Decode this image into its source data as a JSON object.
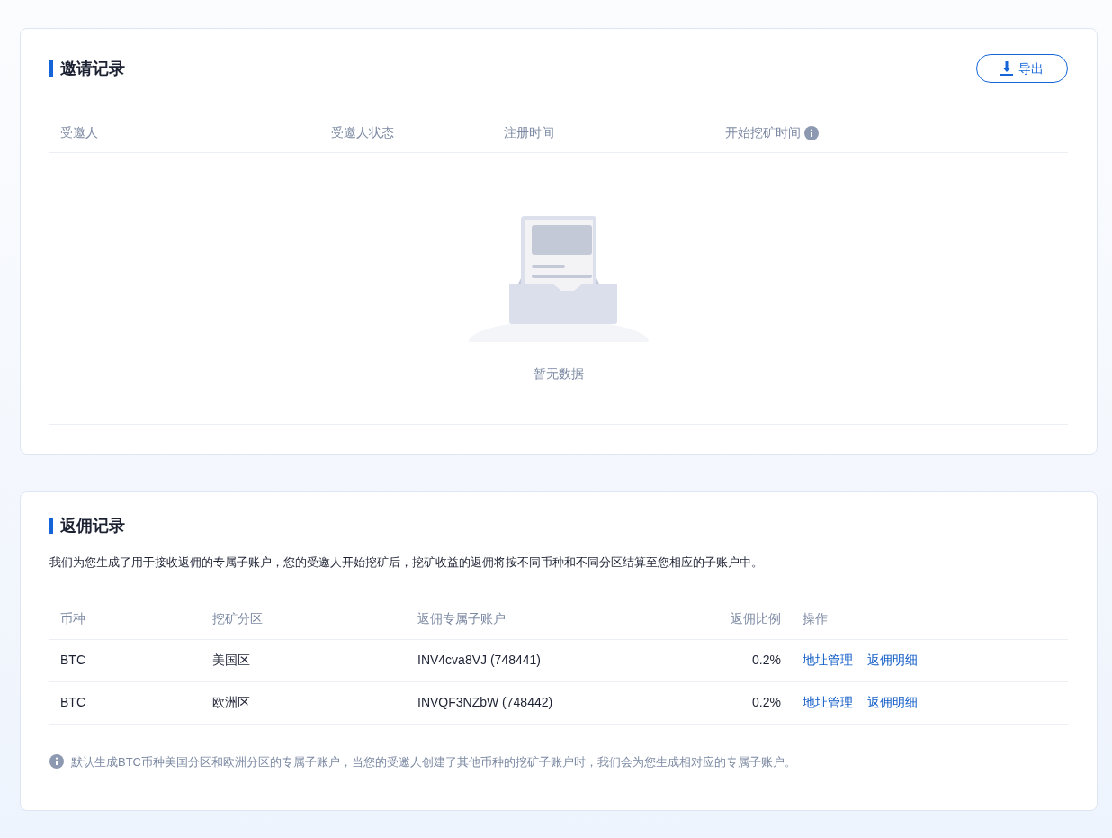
{
  "invite_records": {
    "title": "邀请记录",
    "export_button": "导出",
    "columns": [
      {
        "label": "受邀人",
        "info": false
      },
      {
        "label": "受邀人状态",
        "info": false
      },
      {
        "label": "注册时间",
        "info": false
      },
      {
        "label": "开始挖矿时间",
        "info": true
      }
    ],
    "empty_text": "暂无数据"
  },
  "rebate_records": {
    "title": "返佣记录",
    "description": "我们为您生成了用于接收返佣的专属子账户，您的受邀人开始挖矿后，挖矿收益的返佣将按不同币种和不同分区结算至您相应的子账户中。",
    "columns": [
      "币种",
      "挖矿分区",
      "返佣专属子账户",
      "返佣比例",
      "操作"
    ],
    "rows": [
      {
        "coin": "BTC",
        "zone": "美国区",
        "account": "INV4cva8VJ (748441)",
        "ratio": "0.2%",
        "actions": [
          "地址管理",
          "返佣明细"
        ]
      },
      {
        "coin": "BTC",
        "zone": "欧洲区",
        "account": "INVQF3NZbW (748442)",
        "ratio": "0.2%",
        "actions": [
          "地址管理",
          "返佣明细"
        ]
      }
    ],
    "note": "默认生成BTC币种美国分区和欧洲分区的专属子账户，当您的受邀人创建了其他币种的挖矿子账户时，我们会为您生成相对应的专属子账户。"
  }
}
